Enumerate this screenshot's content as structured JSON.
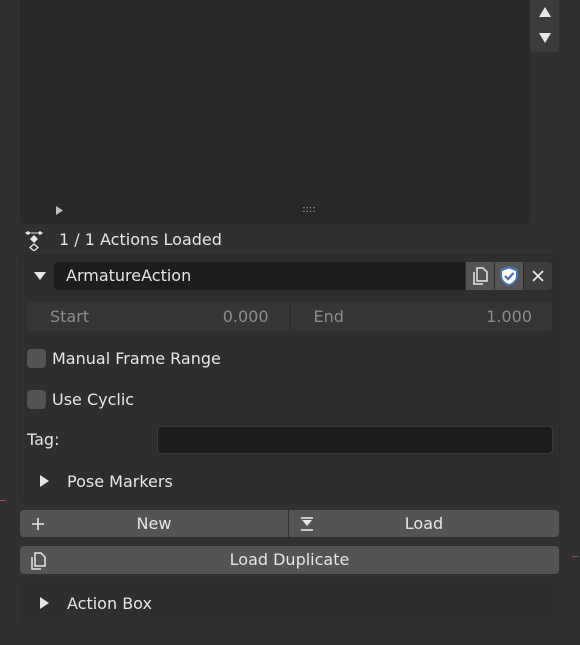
{
  "status": {
    "text": "1 / 1 Actions Loaded"
  },
  "action": {
    "name": "ArmatureAction",
    "start_label": "Start",
    "start_value": "0.000",
    "end_label": "End",
    "end_value": "1.000",
    "manual_frame_range_label": "Manual Frame Range",
    "manual_frame_range_checked": false,
    "use_cyclic_label": "Use Cyclic",
    "use_cyclic_checked": false,
    "tag_label": "Tag:",
    "tag_value": "",
    "pose_markers_label": "Pose Markers"
  },
  "buttons": {
    "new_label": "New",
    "load_label": "Load",
    "load_duplicate_label": "Load Duplicate"
  },
  "action_box": {
    "label": "Action Box"
  },
  "list": {
    "grip": "::::"
  },
  "colors": {
    "fake_user_accent": "#4772b3",
    "background": "#303030",
    "field": "#1d1d1d",
    "button": "#545454"
  },
  "icons": {
    "status": "action-icon",
    "copy": "duplicate-icon",
    "fake_user": "shield-icon",
    "unlink": "close-icon",
    "new": "plus-icon",
    "load": "import-icon",
    "load_duplicate": "duplicate-icon"
  }
}
